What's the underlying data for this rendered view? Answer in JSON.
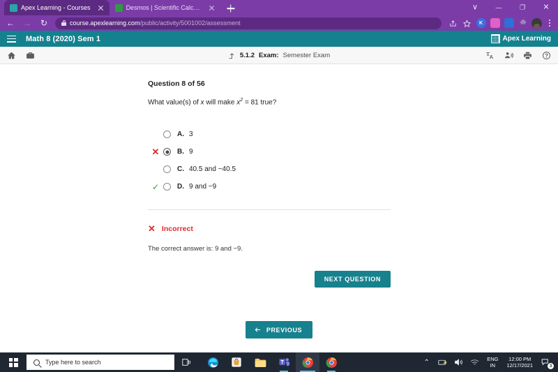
{
  "browser": {
    "tabs": [
      {
        "title": "Apex Learning - Courses",
        "active": true,
        "favicon_color": "#29a6a6"
      },
      {
        "title": "Desmos | Scientific Calculator",
        "active": false,
        "favicon_color": "#2d9c3f"
      }
    ],
    "new_tab_label": "+",
    "window_controls": {
      "minimize": "—",
      "maximize": "❐",
      "close": "✕",
      "chevron": "∨"
    },
    "nav": {
      "back": "←",
      "forward": "→",
      "reload": "↻"
    },
    "address": {
      "lock_icon": "lock-icon",
      "domain": "course.apexlearning.com",
      "path": "/public/activity/5001002/assessment"
    },
    "toolbar_icons": [
      {
        "name": "share-icon",
        "glyph": "⤴"
      },
      {
        "name": "bookmark-star-icon",
        "glyph": "☆"
      }
    ],
    "extensions": [
      {
        "name": "kami-extension",
        "label": "K",
        "color": "#3b6fe0"
      },
      {
        "name": "pink-extension",
        "label": "▦",
        "color": "#e060c8"
      },
      {
        "name": "grid-extension",
        "label": "⬚",
        "color": "#2f6fd8"
      },
      {
        "name": "puzzle-extension",
        "label": "❖",
        "color": "#8b7aa8"
      },
      {
        "name": "profile-avatar",
        "label": "",
        "color": "#3a3a3a"
      }
    ],
    "menu_icon": "kebab-menu-icon",
    "theme_color": "#7b3ca8"
  },
  "apex_header": {
    "menu_icon": "hamburger-menu-icon",
    "course_title": "Math 8 (2020) Sem 1",
    "brand_name": "Apex Learning",
    "brand_color": "#14818f"
  },
  "apex_toolbar": {
    "left_icons": [
      {
        "name": "home-icon"
      },
      {
        "name": "briefcase-icon"
      }
    ],
    "breadcrumb": {
      "up_icon": "go-up-icon",
      "number": "5.1.2",
      "label": "Exam:",
      "value": "Semester Exam"
    },
    "right_icons": [
      {
        "name": "translate-icon"
      },
      {
        "name": "read-aloud-icon"
      },
      {
        "name": "print-icon"
      },
      {
        "name": "help-icon"
      }
    ]
  },
  "question": {
    "counter": "Question 8 of 56",
    "prompt_prefix": "What value(s) of ",
    "prompt_var": "x",
    "prompt_mid": " will make ",
    "prompt_var2": "x",
    "prompt_exp": "2",
    "prompt_suffix": " = 81 true?",
    "options": [
      {
        "letter": "A.",
        "text": "3",
        "selected": false,
        "mark": "none"
      },
      {
        "letter": "B.",
        "text": "9",
        "selected": true,
        "mark": "incorrect"
      },
      {
        "letter": "C.",
        "text": "40.5 and −40.5",
        "selected": false,
        "mark": "none"
      },
      {
        "letter": "D.",
        "text": "9 and −9",
        "selected": false,
        "mark": "correct"
      }
    ],
    "feedback": {
      "icon": "x-mark-icon",
      "status": "Incorrect",
      "status_color": "#de2c2c",
      "correct_answer_text": "The correct answer is: 9 and −9."
    },
    "next_button": "NEXT QUESTION",
    "previous_button": "PREVIOUS",
    "button_color": "#17818e"
  },
  "taskbar": {
    "start_icon": "windows-start-icon",
    "search_placeholder": "Type here to search",
    "search_icon": "search-icon",
    "task_view_icon": "task-view-icon",
    "apps": [
      {
        "name": "edge-icon"
      },
      {
        "name": "microsoft-store-icon"
      },
      {
        "name": "file-explorer-icon"
      },
      {
        "name": "microsoft-teams-icon"
      },
      {
        "name": "chrome-icon-active"
      },
      {
        "name": "chrome-icon-second"
      }
    ],
    "tray": {
      "chevron": "⌃",
      "battery_icon": "battery-warning-icon",
      "volume_icon": "volume-icon",
      "network_icon": "wifi-icon",
      "language_line1": "ENG",
      "language_line2": "IN",
      "time": "12:00 PM",
      "date": "12/17/2021",
      "notification_icon": "notifications-icon",
      "notification_count": "3"
    }
  }
}
